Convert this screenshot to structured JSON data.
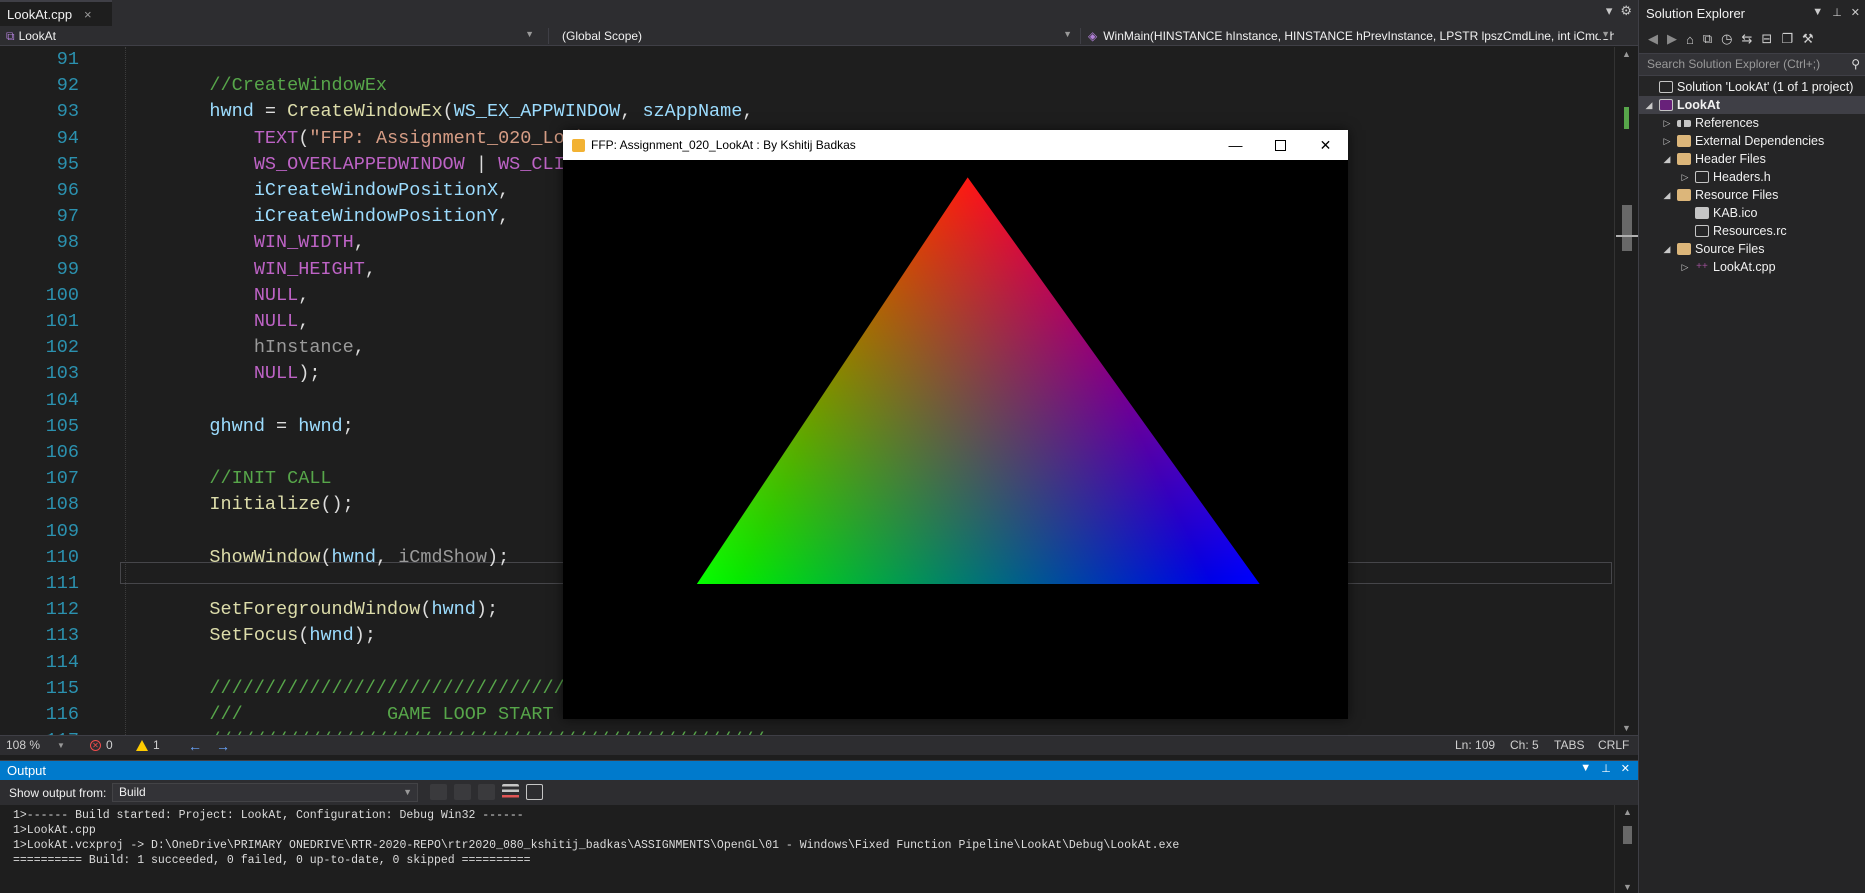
{
  "editor": {
    "tab": {
      "filename": "LookAt.cpp",
      "close_glyph": "×"
    },
    "tabbar_icons": [
      "▾",
      "⚙"
    ],
    "nav": {
      "project": "LookAt",
      "scope": "(Global Scope)",
      "member": "WinMain(HINSTANCE hInstance, HINSTANCE hPrevInstance, LPSTR lpszCmdLine, int iCmdShow)"
    },
    "lines": [
      {
        "n": "91",
        "segs": []
      },
      {
        "n": "92",
        "segs": [
          {
            "c": "comment",
            "t": "    //CreateWindowEx"
          }
        ]
      },
      {
        "n": "93",
        "segs": [
          {
            "c": "var",
            "t": "    hwnd"
          },
          {
            "c": "plain",
            "t": " = "
          },
          {
            "c": "fn",
            "t": "CreateWindowEx"
          },
          {
            "c": "plain",
            "t": "("
          },
          {
            "c": "var",
            "t": "WS_EX_APPWINDOW"
          },
          {
            "c": "plain",
            "t": ", "
          },
          {
            "c": "var",
            "t": "szAppName"
          },
          {
            "c": "plain",
            "t": ","
          }
        ]
      },
      {
        "n": "94",
        "segs": [
          {
            "c": "macro",
            "t": "        TEXT"
          },
          {
            "c": "plain",
            "t": "("
          },
          {
            "c": "str",
            "t": "\"FFP: Assignment_020_LookAt"
          }
        ]
      },
      {
        "n": "95",
        "segs": [
          {
            "c": "macro",
            "t": "        WS_OVERLAPPEDWINDOW"
          },
          {
            "c": "plain",
            "t": " | "
          },
          {
            "c": "macro",
            "t": "WS_CLIPCHI"
          }
        ]
      },
      {
        "n": "96",
        "segs": [
          {
            "c": "var",
            "t": "        iCreateWindowPositionX"
          },
          {
            "c": "plain",
            "t": ","
          }
        ]
      },
      {
        "n": "97",
        "segs": [
          {
            "c": "var",
            "t": "        iCreateWindowPositionY"
          },
          {
            "c": "plain",
            "t": ","
          }
        ]
      },
      {
        "n": "98",
        "segs": [
          {
            "c": "macro",
            "t": "        WIN_WIDTH"
          },
          {
            "c": "plain",
            "t": ","
          }
        ]
      },
      {
        "n": "99",
        "segs": [
          {
            "c": "macro",
            "t": "        WIN_HEIGHT"
          },
          {
            "c": "plain",
            "t": ","
          }
        ]
      },
      {
        "n": "100",
        "segs": [
          {
            "c": "macro",
            "t": "        NULL"
          },
          {
            "c": "plain",
            "t": ","
          }
        ]
      },
      {
        "n": "101",
        "segs": [
          {
            "c": "macro",
            "t": "        NULL"
          },
          {
            "c": "plain",
            "t": ","
          }
        ]
      },
      {
        "n": "102",
        "segs": [
          {
            "c": "param",
            "t": "        hInstance"
          },
          {
            "c": "plain",
            "t": ","
          }
        ]
      },
      {
        "n": "103",
        "segs": [
          {
            "c": "macro",
            "t": "        NULL"
          },
          {
            "c": "plain",
            "t": ");"
          }
        ]
      },
      {
        "n": "104",
        "segs": []
      },
      {
        "n": "105",
        "segs": [
          {
            "c": "var",
            "t": "    ghwnd"
          },
          {
            "c": "plain",
            "t": " = "
          },
          {
            "c": "var",
            "t": "hwnd"
          },
          {
            "c": "plain",
            "t": ";"
          }
        ]
      },
      {
        "n": "106",
        "segs": []
      },
      {
        "n": "107",
        "segs": [
          {
            "c": "comment",
            "t": "    //INIT CALL"
          }
        ]
      },
      {
        "n": "108",
        "segs": [
          {
            "c": "fn",
            "t": "    Initialize"
          },
          {
            "c": "plain",
            "t": "();"
          }
        ]
      },
      {
        "n": "109",
        "segs": []
      },
      {
        "n": "110",
        "segs": [
          {
            "c": "fn",
            "t": "    ShowWindow"
          },
          {
            "c": "plain",
            "t": "("
          },
          {
            "c": "var",
            "t": "hwnd"
          },
          {
            "c": "plain",
            "t": ", "
          },
          {
            "c": "param",
            "t": "iCmdShow"
          },
          {
            "c": "plain",
            "t": ");"
          }
        ]
      },
      {
        "n": "111",
        "segs": []
      },
      {
        "n": "112",
        "segs": [
          {
            "c": "fn",
            "t": "    SetForegroundWindow"
          },
          {
            "c": "plain",
            "t": "("
          },
          {
            "c": "var",
            "t": "hwnd"
          },
          {
            "c": "plain",
            "t": ");"
          }
        ]
      },
      {
        "n": "113",
        "segs": [
          {
            "c": "fn",
            "t": "    SetFocus"
          },
          {
            "c": "plain",
            "t": "("
          },
          {
            "c": "var",
            "t": "hwnd"
          },
          {
            "c": "plain",
            "t": ");"
          }
        ]
      },
      {
        "n": "114",
        "segs": []
      },
      {
        "n": "115",
        "segs": [
          {
            "c": "comment",
            "t": "    ////////////////////////////////////////"
          }
        ]
      },
      {
        "n": "116",
        "segs": [
          {
            "c": "comment",
            "t": "    ///             GAME LOOP START"
          }
        ]
      },
      {
        "n": "117",
        "segs": [
          {
            "c": "comment",
            "t": "    //////////////////////////////////////////////////"
          }
        ]
      }
    ]
  },
  "statusbar": {
    "zoom": "108 %",
    "errors": "0",
    "warnings": "1",
    "ln": "Ln: 109",
    "ch": "Ch: 5",
    "tabs": "TABS",
    "eol": "CRLF"
  },
  "output": {
    "title": "Output",
    "show_from_label": "Show output from:",
    "source": "Build",
    "text": "1>------ Build started: Project: LookAt, Configuration: Debug Win32 ------\n1>LookAt.cpp\n1>LookAt.vcxproj -> D:\\OneDrive\\PRIMARY ONEDRIVE\\RTR-2020-REPO\\rtr2020_080_kshitij_badkas\\ASSIGNMENTS\\OpenGL\\01 - Windows\\Fixed Function Pipeline\\LookAt\\Debug\\LookAt.exe\n========== Build: 1 succeeded, 0 failed, 0 up-to-date, 0 skipped =========="
  },
  "solution_explorer": {
    "title": "Solution Explorer",
    "search_placeholder": "Search Solution Explorer (Ctrl+;)",
    "items": [
      {
        "label": "Solution 'LookAt' (1 of 1 project)",
        "indent": 0,
        "twisty": "",
        "icon": "solution-icon",
        "selected": false
      },
      {
        "label": "LookAt",
        "indent": 0,
        "twisty": "◢",
        "icon": "project-icon",
        "selected": true
      },
      {
        "label": "References",
        "indent": 1,
        "twisty": "▷",
        "icon": "references-icon",
        "selected": false
      },
      {
        "label": "External Dependencies",
        "indent": 1,
        "twisty": "▷",
        "icon": "external-dependencies-icon",
        "selected": false
      },
      {
        "label": "Header Files",
        "indent": 1,
        "twisty": "◢",
        "icon": "folder-icon",
        "selected": false
      },
      {
        "label": "Headers.h",
        "indent": 2,
        "twisty": "▷",
        "icon": "header-file-icon",
        "selected": false
      },
      {
        "label": "Resource Files",
        "indent": 1,
        "twisty": "◢",
        "icon": "folder-icon",
        "selected": false
      },
      {
        "label": "KAB.ico",
        "indent": 2,
        "twisty": "",
        "icon": "icon-file-icon",
        "selected": false
      },
      {
        "label": "Resources.rc",
        "indent": 2,
        "twisty": "",
        "icon": "resource-file-icon",
        "selected": false
      },
      {
        "label": "Source Files",
        "indent": 1,
        "twisty": "◢",
        "icon": "folder-icon",
        "selected": false
      },
      {
        "label": "LookAt.cpp",
        "indent": 2,
        "twisty": "▷",
        "icon": "cpp-file-icon",
        "selected": false
      }
    ]
  },
  "glwindow": {
    "caption": "FFP: Assignment_020_LookAt : By Kshitij Badkas",
    "triangle_colors": {
      "top": "#ff0000",
      "bottom_left": "#00ff00",
      "bottom_right": "#0000ff"
    }
  }
}
